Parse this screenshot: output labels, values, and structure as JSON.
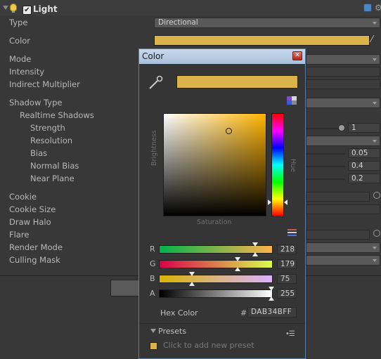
{
  "component": {
    "title": "Light",
    "enabled": true
  },
  "properties": [
    {
      "label": "Type"
    },
    {
      "label": "Color"
    },
    {
      "label": "Mode"
    },
    {
      "label": "Intensity"
    },
    {
      "label": "Indirect Multiplier"
    },
    {
      "label": "Shadow Type"
    },
    {
      "label": "Realtime Shadows"
    },
    {
      "label": "Strength"
    },
    {
      "label": "Resolution"
    },
    {
      "label": "Bias"
    },
    {
      "label": "Normal Bias"
    },
    {
      "label": "Near Plane"
    },
    {
      "label": "Cookie"
    },
    {
      "label": "Cookie Size"
    },
    {
      "label": "Draw Halo"
    },
    {
      "label": "Flare"
    },
    {
      "label": "Render Mode"
    },
    {
      "label": "Culling Mask"
    }
  ],
  "values": {
    "type": "Directional",
    "strength": "1",
    "bias": "0.05",
    "normal_bias": "0.4",
    "near_plane": "0.2"
  },
  "color_window": {
    "title": "Color",
    "current_color": "#DAB34B",
    "brightness_label": "Brightness",
    "saturation_label": "Saturation",
    "hue_label": "Hue",
    "channels": [
      {
        "label": "R",
        "value": "218",
        "fraction": 0.855
      },
      {
        "label": "G",
        "value": "179",
        "fraction": 0.702
      },
      {
        "label": "B",
        "value": "75",
        "fraction": 0.294
      },
      {
        "label": "A",
        "value": "255",
        "fraction": 1.0
      }
    ],
    "hex_label": "Hex Color",
    "hex_prefix": "#",
    "hex_value": "DAB34BFF",
    "presets_label": "Presets",
    "add_preset_text": "Click to add new preset"
  },
  "icons": {
    "bulb": "light-bulb-icon",
    "help": "help-icon",
    "settings": "gear-icon",
    "eyedropper": "eyedropper-icon",
    "close": "close-icon"
  }
}
